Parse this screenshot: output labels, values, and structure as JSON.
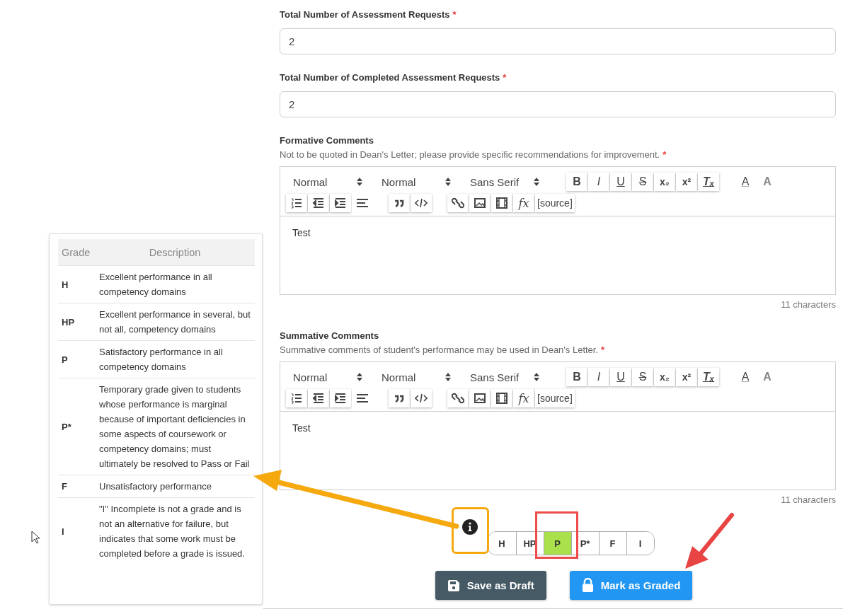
{
  "fields": [
    {
      "label": "Total Number of Assessment Requests",
      "required_mark": "*",
      "value": "2"
    },
    {
      "label": "Total Number of Completed Assessment Requests",
      "required_mark": "*",
      "value": "2"
    }
  ],
  "editors": [
    {
      "label": "Formative Comments",
      "hint": "Not to be quoted in Dean's Letter; please provide specific recommendations for improvement.",
      "required_mark": "*",
      "toolbar_rows": [
        [
          [
            {
              "kind": "select",
              "label": "Normal"
            },
            {
              "kind": "select",
              "label": "Normal"
            },
            {
              "kind": "select",
              "label": "Sans Serif"
            }
          ],
          [
            {
              "kind": "bold",
              "label": "B"
            },
            {
              "kind": "italic",
              "label": "I"
            },
            {
              "kind": "underline",
              "label": "U"
            },
            {
              "kind": "strike",
              "label": "S"
            },
            {
              "kind": "sub",
              "label": "x₂"
            },
            {
              "kind": "sup",
              "label": "x²"
            },
            {
              "kind": "clean",
              "label": "Tₓ"
            }
          ],
          [
            {
              "kind": "color",
              "label": "A"
            },
            {
              "kind": "background",
              "label": "A"
            }
          ]
        ],
        [
          [
            {
              "kind": "ol"
            },
            {
              "kind": "outdent"
            },
            {
              "kind": "indent"
            },
            {
              "kind": "align"
            }
          ],
          [
            {
              "kind": "quote"
            },
            {
              "kind": "code"
            }
          ],
          [
            {
              "kind": "link"
            },
            {
              "kind": "image"
            },
            {
              "kind": "video"
            },
            {
              "kind": "formula",
              "label": "fx"
            },
            {
              "kind": "source",
              "label": "[source]"
            }
          ]
        ]
      ],
      "text": "Test",
      "count": "11 characters"
    },
    {
      "label": "Summative Comments",
      "hint": "Summative comments of student's performance may be used in Dean's Letter.",
      "required_mark": "*",
      "toolbar_rows": [
        [
          [
            {
              "kind": "select",
              "label": "Normal"
            },
            {
              "kind": "select",
              "label": "Normal"
            },
            {
              "kind": "select",
              "label": "Sans Serif"
            }
          ],
          [
            {
              "kind": "bold",
              "label": "B"
            },
            {
              "kind": "italic",
              "label": "I"
            },
            {
              "kind": "underline",
              "label": "U"
            },
            {
              "kind": "strike",
              "label": "S"
            },
            {
              "kind": "sub",
              "label": "x₂"
            },
            {
              "kind": "sup",
              "label": "x²"
            },
            {
              "kind": "clean",
              "label": "Tₓ"
            }
          ],
          [
            {
              "kind": "color",
              "label": "A"
            },
            {
              "kind": "background",
              "label": "A"
            }
          ]
        ],
        [
          [
            {
              "kind": "ol"
            },
            {
              "kind": "outdent"
            },
            {
              "kind": "indent"
            },
            {
              "kind": "align"
            }
          ],
          [
            {
              "kind": "quote"
            },
            {
              "kind": "code"
            }
          ],
          [
            {
              "kind": "link"
            },
            {
              "kind": "image"
            },
            {
              "kind": "video"
            },
            {
              "kind": "formula",
              "label": "fx"
            },
            {
              "kind": "source",
              "label": "[source]"
            }
          ]
        ]
      ],
      "text": "Test",
      "count": "11 characters"
    }
  ],
  "grade_table": {
    "columns": [
      "Grade",
      "Description"
    ],
    "rows": [
      {
        "grade": "H",
        "description": "Excellent performance in all competency domains"
      },
      {
        "grade": "HP",
        "description": "Excellent performance in several, but not all, competency domains"
      },
      {
        "grade": "P",
        "description": "Satisfactory performance in all competency domains"
      },
      {
        "grade": "P*",
        "description": "Temporary grade given to students whose performance is marginal because of important deficiencies in some aspects of coursework or competency domains; must ultimately be resolved to Pass or Fail"
      },
      {
        "grade": "F",
        "description": "Unsatisfactory performance"
      },
      {
        "grade": "I",
        "description": "\"I\" Incomplete is not a grade and is not an alternative for failure, but indicates that some work must be completed before a grade is issued."
      }
    ]
  },
  "grades": [
    {
      "label": "H",
      "selected": false
    },
    {
      "label": "HP",
      "selected": false
    },
    {
      "label": "P",
      "selected": true
    },
    {
      "label": "P*",
      "selected": false
    },
    {
      "label": "F",
      "selected": false
    },
    {
      "label": "I",
      "selected": false
    }
  ],
  "buttons": [
    {
      "kind": "draft",
      "label": "Save as Draft"
    },
    {
      "kind": "graded",
      "label": "Mark as Graded"
    }
  ]
}
